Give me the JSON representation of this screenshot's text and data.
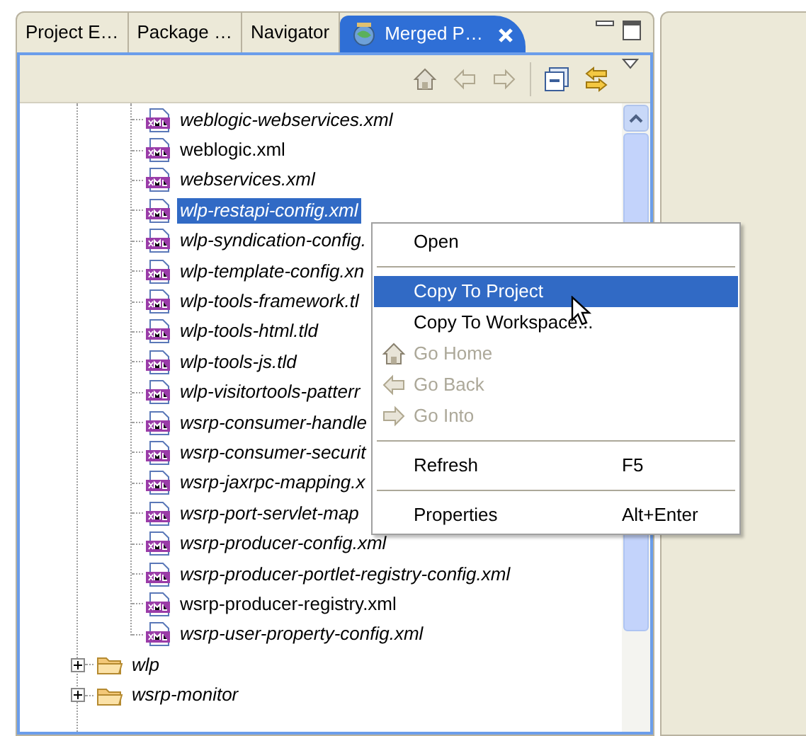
{
  "tabs": [
    {
      "label": "Project E…",
      "selected": false
    },
    {
      "label": "Package …",
      "selected": false
    },
    {
      "label": "Navigator",
      "selected": false
    },
    {
      "label": "Merged P…",
      "selected": true,
      "closable": true
    }
  ],
  "tree": {
    "files": [
      {
        "name": "weblogic-webservices.xml",
        "italic": true,
        "selected": false
      },
      {
        "name": "weblogic.xml",
        "italic": false,
        "selected": false
      },
      {
        "name": "webservices.xml",
        "italic": true,
        "selected": false
      },
      {
        "name": "wlp-restapi-config.xml",
        "italic": true,
        "selected": true
      },
      {
        "name": "wlp-syndication-config.",
        "italic": true,
        "selected": false
      },
      {
        "name": "wlp-template-config.xn",
        "italic": true,
        "selected": false
      },
      {
        "name": "wlp-tools-framework.tl",
        "italic": true,
        "selected": false
      },
      {
        "name": "wlp-tools-html.tld",
        "italic": true,
        "selected": false
      },
      {
        "name": "wlp-tools-js.tld",
        "italic": true,
        "selected": false
      },
      {
        "name": "wlp-visitortools-patterr",
        "italic": true,
        "selected": false
      },
      {
        "name": "wsrp-consumer-handle",
        "italic": true,
        "selected": false
      },
      {
        "name": "wsrp-consumer-securit",
        "italic": true,
        "selected": false
      },
      {
        "name": "wsrp-jaxrpc-mapping.x",
        "italic": true,
        "selected": false
      },
      {
        "name": "wsrp-port-servlet-map",
        "italic": true,
        "selected": false
      },
      {
        "name": "wsrp-producer-config.xml",
        "italic": true,
        "selected": false
      },
      {
        "name": "wsrp-producer-portlet-registry-config.xml",
        "italic": true,
        "selected": false
      },
      {
        "name": "wsrp-producer-registry.xml",
        "italic": false,
        "selected": false
      },
      {
        "name": "wsrp-user-property-config.xml",
        "italic": true,
        "selected": false
      }
    ],
    "folders": [
      {
        "name": "wlp",
        "italic": true,
        "expanded": false
      },
      {
        "name": "wsrp-monitor",
        "italic": true,
        "expanded": false
      }
    ]
  },
  "context_menu": [
    {
      "kind": "item",
      "label": "Open",
      "disabled": false,
      "selected": false
    },
    {
      "kind": "separator"
    },
    {
      "kind": "item",
      "label": "Copy To Project",
      "disabled": false,
      "selected": true
    },
    {
      "kind": "item",
      "label": "Copy To Workspace...",
      "disabled": false,
      "selected": false
    },
    {
      "kind": "home",
      "label": "Go Home",
      "disabled": true,
      "selected": false
    },
    {
      "kind": "back",
      "label": "Go Back",
      "disabled": true,
      "selected": false
    },
    {
      "kind": "forward",
      "label": "Go Into",
      "disabled": true,
      "selected": false
    },
    {
      "kind": "separator"
    },
    {
      "kind": "item",
      "label": "Refresh",
      "shortcut": "F5",
      "disabled": false,
      "selected": false
    },
    {
      "kind": "separator"
    },
    {
      "kind": "item",
      "label": "Properties",
      "shortcut": "Alt+Enter",
      "disabled": false,
      "selected": false
    }
  ]
}
